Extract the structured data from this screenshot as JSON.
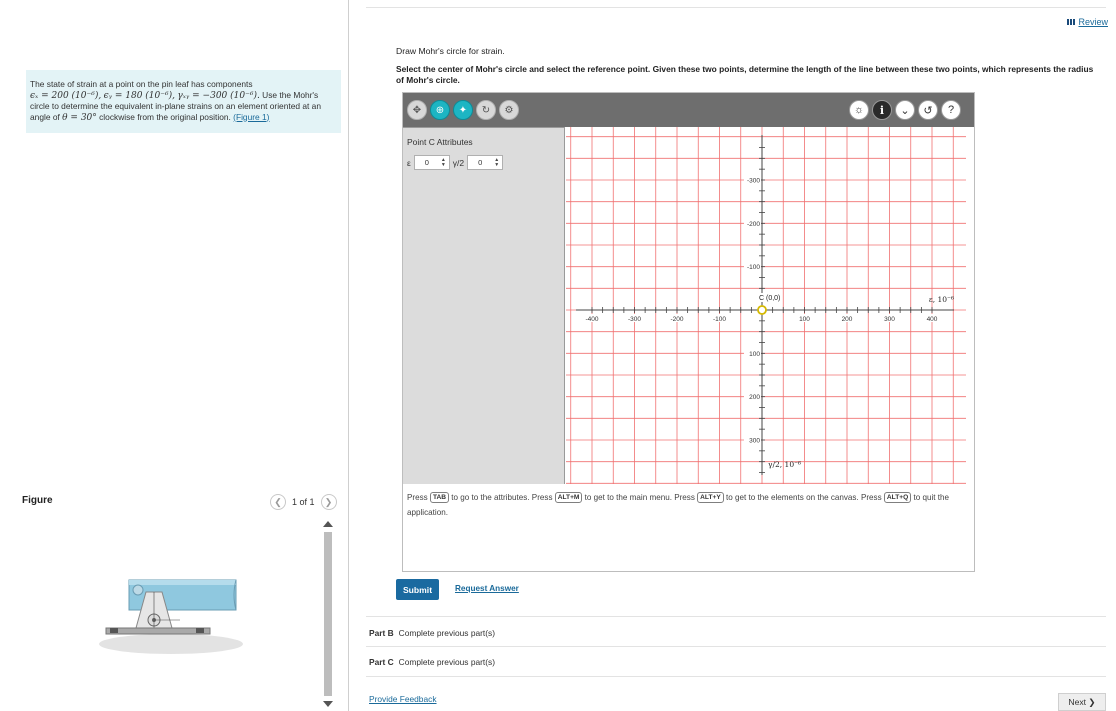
{
  "problem": {
    "text_a": "The state of strain at a point on the pin leaf has components",
    "math_eps_x": "ϵₓ = 200 (10⁻⁶),",
    "math_eps_y": "ϵᵧ = 180 (10⁻⁶),",
    "math_gamma": "γₓᵧ = −300 (10⁻⁶).",
    "text_b": "Use the Mohr's circle to determine the equivalent in-plane strains on an element oriented at an angle of",
    "math_theta": "θ = 30°",
    "text_c": "clockwise from the original position.",
    "figure_link": "(Figure 1)"
  },
  "figure": {
    "label": "Figure",
    "pager_text": "1 of 1",
    "prev_icon": "chevron-left-icon",
    "next_icon": "chevron-right-icon"
  },
  "header": {
    "review_label": "Review",
    "review_icon": "list-icon"
  },
  "instructions": {
    "line1": "Draw Mohr's circle for strain.",
    "line2": "Select the center of Mohr's circle and select the reference point. Given these two points, determine the length of the line between these two points, which represents the radius of Mohr's circle."
  },
  "toolbar": {
    "left_icons": [
      "move-icon",
      "center-icon",
      "reference-point-icon",
      "rotate-icon",
      "settings-icon"
    ],
    "right_icons": [
      "hint-icon",
      "info-icon",
      "dropdown-icon",
      "reset-icon",
      "help-icon"
    ],
    "info_glyph": "i",
    "help_glyph": "?"
  },
  "attributes": {
    "title": "Point C Attributes",
    "eps_label": "ε",
    "eps_value": "0",
    "gamma_label": "γ/2",
    "gamma_value": "0"
  },
  "chart_data": {
    "type": "scatter",
    "xlim": [
      -400,
      400
    ],
    "ylim": [
      -300,
      300
    ],
    "x_ticks": [
      -400,
      -300,
      -200,
      -100,
      100,
      200,
      300,
      400
    ],
    "y_ticks_labels": [
      "-300",
      "-200",
      "-100",
      "100",
      "200",
      "300"
    ],
    "y_ticks_values": [
      300,
      200,
      100,
      -100,
      -200,
      -300
    ],
    "xlabel": "ε, 10⁻⁶",
    "ylabel": "γ/2, 10⁻⁶",
    "points": [
      {
        "label": "C (0,0)",
        "x": 0,
        "y": 0
      }
    ],
    "grid": true,
    "grid_color": "#f07070",
    "axis_color": "#444444",
    "point_color": "#d4b800"
  },
  "help": {
    "p1": "Press",
    "k1": "TAB",
    "p2": "to go to the attributes. Press",
    "k2": "ALT+M",
    "p3": "to get to the main menu. Press",
    "k3": "ALT+Y",
    "p4": "to get to the elements on the canvas. Press",
    "k4": "ALT+Q",
    "p5": "to quit the application."
  },
  "actions": {
    "submit": "Submit",
    "request": "Request Answer"
  },
  "parts": [
    {
      "label": "Part B",
      "status": "Complete previous part(s)"
    },
    {
      "label": "Part C",
      "status": "Complete previous part(s)"
    }
  ],
  "footer": {
    "feedback": "Provide Feedback",
    "next": "Next"
  },
  "colors": {
    "accent": "#1a6aa0",
    "problem_bg": "#e3f3f6",
    "toolbar_bg": "#6e6e6e",
    "active_tool": "#1db5c3"
  }
}
